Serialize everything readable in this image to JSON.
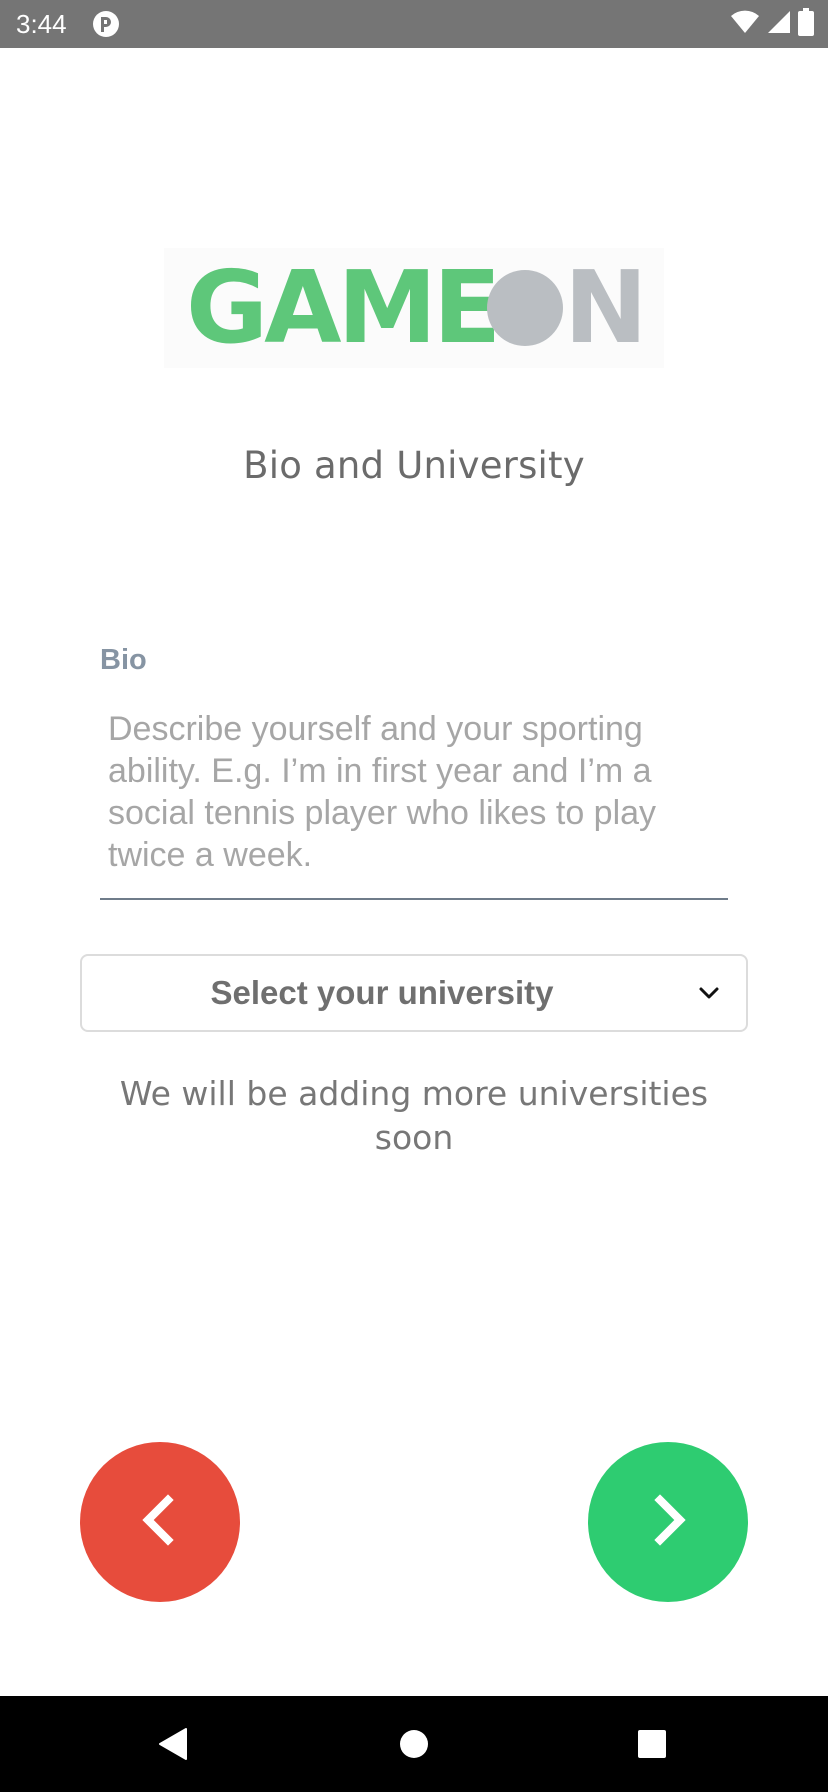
{
  "status_bar": {
    "time": "3:44",
    "icons": [
      "app-notification-icon",
      "wifi-icon",
      "signal-icon",
      "battery-icon"
    ]
  },
  "logo": {
    "text": "GAMEON",
    "colors": {
      "green": "#5ec77a",
      "gray": "#babec2"
    }
  },
  "page": {
    "title": "Bio and University"
  },
  "bio": {
    "label": "Bio",
    "value": "",
    "placeholder": "Describe yourself and your sporting ability. E.g. I’m in first year and I’m a social tennis player who likes to play twice a week."
  },
  "university": {
    "selected": "Select your university",
    "note": "We will be adding more universities soon"
  },
  "navigation": {
    "back_icon": "chevron-left-icon",
    "next_icon": "chevron-right-icon",
    "back_color": "#e74c3c",
    "next_color": "#2ecc71"
  },
  "system_nav": {
    "icons": [
      "back-triangle-icon",
      "home-circle-icon",
      "recents-square-icon"
    ]
  }
}
